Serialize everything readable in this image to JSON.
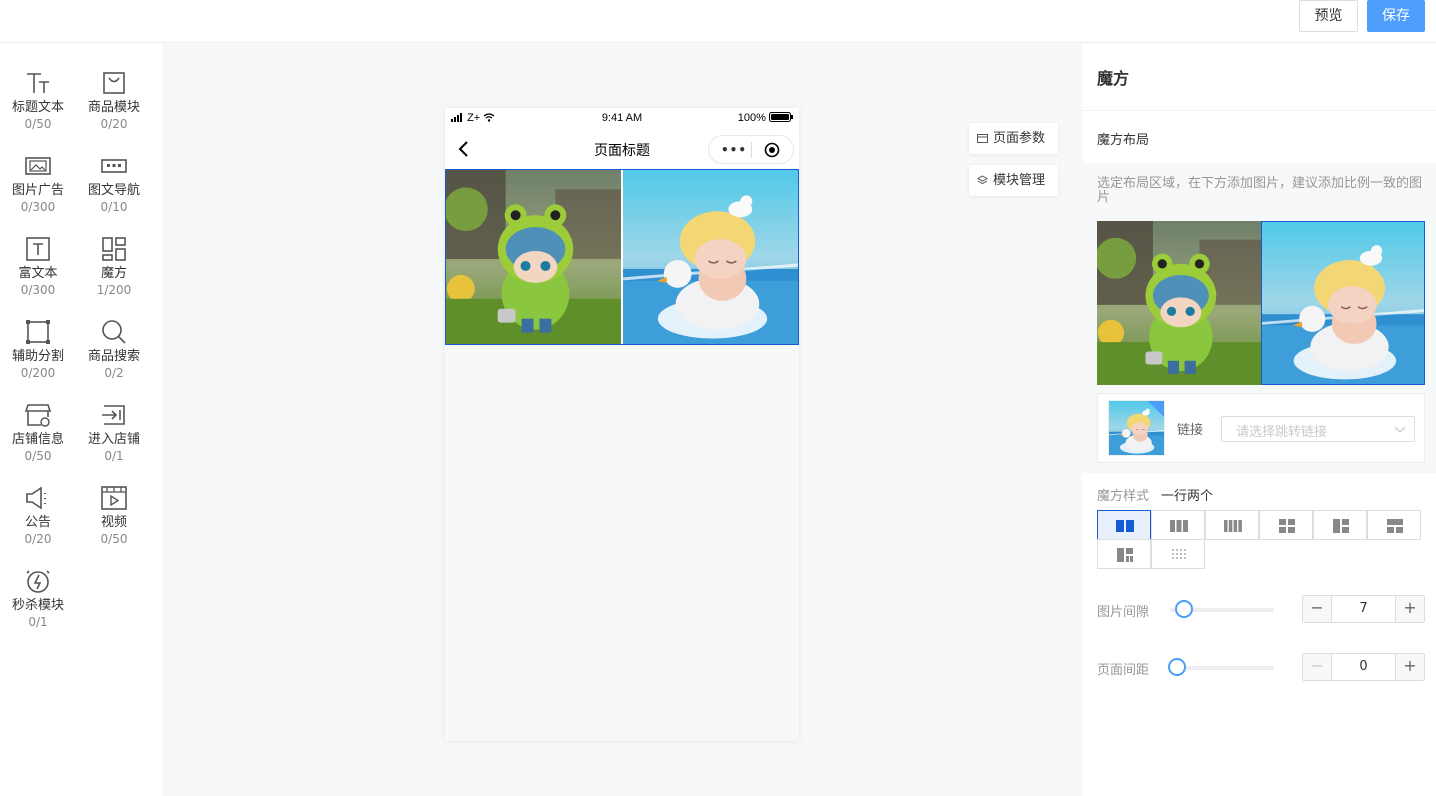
{
  "topbar": {
    "preview_label": "预览",
    "save_label": "保存"
  },
  "components": [
    {
      "name": "标题文本",
      "count": "0/50",
      "icon": "title-text-icon"
    },
    {
      "name": "商品模块",
      "count": "0/20",
      "icon": "shopping-bag-icon"
    },
    {
      "name": "图片广告",
      "count": "0/300",
      "icon": "image-ad-icon"
    },
    {
      "name": "图文导航",
      "count": "0/10",
      "icon": "image-nav-icon"
    },
    {
      "name": "富文本",
      "count": "0/300",
      "icon": "rich-text-icon"
    },
    {
      "name": "魔方",
      "count": "1/200",
      "icon": "cube-icon"
    },
    {
      "name": "辅助分割",
      "count": "0/200",
      "icon": "divider-icon"
    },
    {
      "name": "商品搜索",
      "count": "0/2",
      "icon": "search-icon"
    },
    {
      "name": "店铺信息",
      "count": "0/50",
      "icon": "store-info-icon"
    },
    {
      "name": "进入店铺",
      "count": "0/1",
      "icon": "enter-store-icon"
    },
    {
      "name": "公告",
      "count": "0/20",
      "icon": "announcement-icon"
    },
    {
      "name": "视频",
      "count": "0/50",
      "icon": "video-icon"
    },
    {
      "name": "秒杀模块",
      "count": "0/1",
      "icon": "flash-sale-icon"
    }
  ],
  "phone": {
    "carrier": "Z+",
    "time": "9:41 AM",
    "battery": "100%",
    "page_title": "页面标题",
    "menu_dots": "•••"
  },
  "canvas_buttons": {
    "page_params": "页面参数",
    "module_manage": "模块管理"
  },
  "panel": {
    "title": "魔方",
    "section": "魔方布局",
    "hint": "选定布局区域，在下方添加图片，建议添加比例一致的图片",
    "link_label": "链接",
    "link_placeholder": "请选择跳转链接",
    "style_label": "魔方样式",
    "style_value": "一行两个",
    "gap_label": "图片间隙",
    "gap_value": "7",
    "gap_fraction": 0.07,
    "margin_label": "页面间距",
    "margin_value": "0",
    "margin_fraction": 0.0,
    "minus": "−",
    "plus": "+"
  },
  "colors": {
    "accent": "#4f9efd",
    "selected": "#155bd4"
  }
}
